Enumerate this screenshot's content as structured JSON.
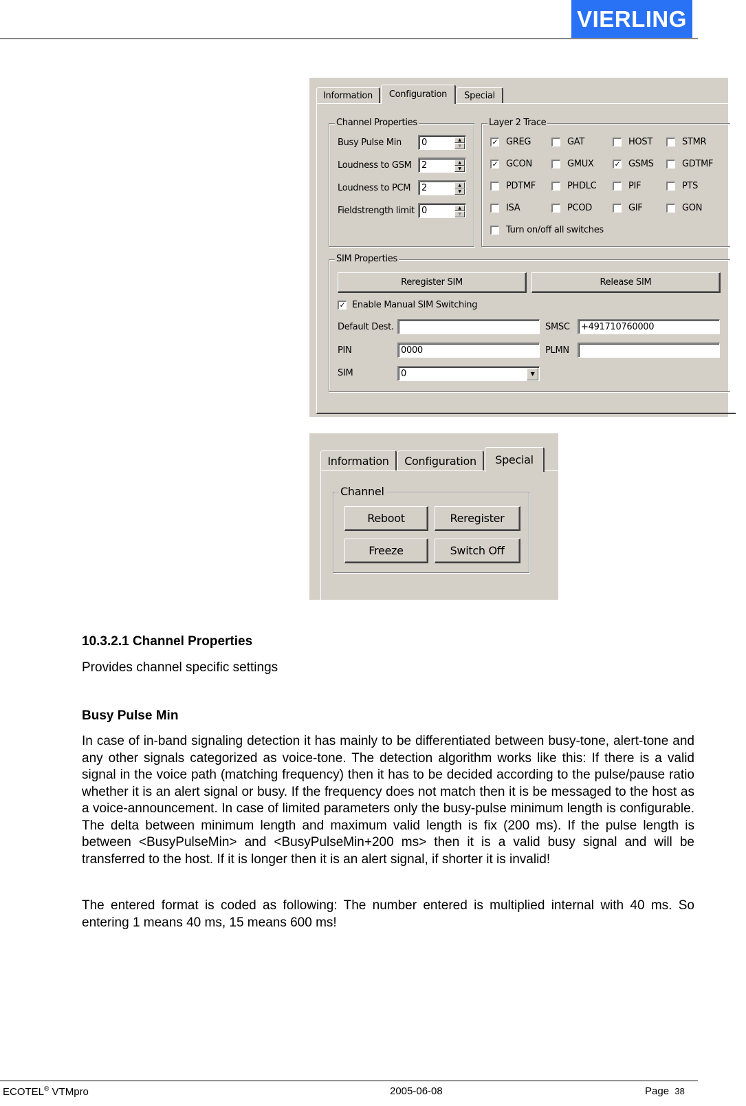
{
  "header": {
    "logo_text": "VIERLING"
  },
  "config_dialog": {
    "tabs": [
      "Information",
      "Configuration",
      "Special"
    ],
    "active_tab": "Configuration",
    "channel_properties": {
      "title": "Channel Properties",
      "fields": [
        {
          "label": "Busy Pulse Min",
          "value": "0"
        },
        {
          "label": "Loudness to GSM",
          "value": "2"
        },
        {
          "label": "Loudness to PCM",
          "value": "2"
        },
        {
          "label": "Fieldstrength limit",
          "value": "0"
        }
      ]
    },
    "layer2_trace": {
      "title": "Layer 2 Trace",
      "switches": [
        {
          "label": "GREG",
          "checked": true
        },
        {
          "label": "GAT",
          "checked": false
        },
        {
          "label": "HOST",
          "checked": false
        },
        {
          "label": "STMR",
          "checked": false
        },
        {
          "label": "GCON",
          "checked": true
        },
        {
          "label": "GMUX",
          "checked": false
        },
        {
          "label": "GSMS",
          "checked": true
        },
        {
          "label": "GDTMF",
          "checked": false
        },
        {
          "label": "PDTMF",
          "checked": false
        },
        {
          "label": "PHDLC",
          "checked": false
        },
        {
          "label": "PIF",
          "checked": false
        },
        {
          "label": "PTS",
          "checked": false
        },
        {
          "label": "ISA",
          "checked": false
        },
        {
          "label": "PCOD",
          "checked": false
        },
        {
          "label": "GIF",
          "checked": false
        },
        {
          "label": "GON",
          "checked": false
        }
      ],
      "all_switch": {
        "label": "Turn on/off all switches",
        "checked": false
      }
    },
    "sim_properties": {
      "title": "SIM Properties",
      "reregister_button": "Reregister SIM",
      "release_button": "Release SIM",
      "manual_switching": {
        "label": "Enable Manual SIM Switching",
        "checked": true
      },
      "default_dest": {
        "label": "Default Dest.",
        "value": ""
      },
      "smsc": {
        "label": "SMSC",
        "value": "+491710760000"
      },
      "pin": {
        "label": "PIN",
        "value": "0000"
      },
      "plmn": {
        "label": "PLMN",
        "value": ""
      },
      "sim": {
        "label": "SIM",
        "value": "0"
      }
    }
  },
  "special_dialog": {
    "tabs": [
      "Information",
      "Configuration",
      "Special"
    ],
    "active_tab": "Special",
    "channel_group": {
      "title": "Channel",
      "buttons": [
        "Reboot",
        "Reregister",
        "Freeze",
        "Switch Off"
      ]
    }
  },
  "content": {
    "section_heading": "10.3.2.1 Channel Properties",
    "section_intro": "Provides channel specific settings",
    "subheading": "Busy Pulse Min",
    "paragraph1": "In case of in-band signaling detection it has mainly to be differentiated between busy-tone, alert-tone and any other signals categorized as voice-tone. The detection algorithm works like this: If there is a valid signal in the voice path (matching frequency) then it has to be decided according to the pulse/pause ratio whether it is an alert signal or busy. If the frequency does not match then it is be messaged to the host as a voice-announcement. In case of limited parameters only the busy-pulse minimum length is configurable. The delta between minimum length and maximum valid length is fix (200 ms). If the pulse length is between <BusyPulseMin> and <BusyPulseMin+200 ms> then it is a valid busy signal and will be transferred to the host. If it is longer then it is an alert signal, if shorter it is invalid!",
    "paragraph2": "The entered format is coded as following: The number entered is multiplied internal with 40 ms. So entering 1 means 40 ms, 15 means 600 ms!"
  },
  "footer": {
    "product": "ECOTEL",
    "registered_mark": "®",
    "product_suffix": " VTMpro",
    "date": "2005-06-08",
    "page_label": "Page",
    "page_number": "38"
  }
}
